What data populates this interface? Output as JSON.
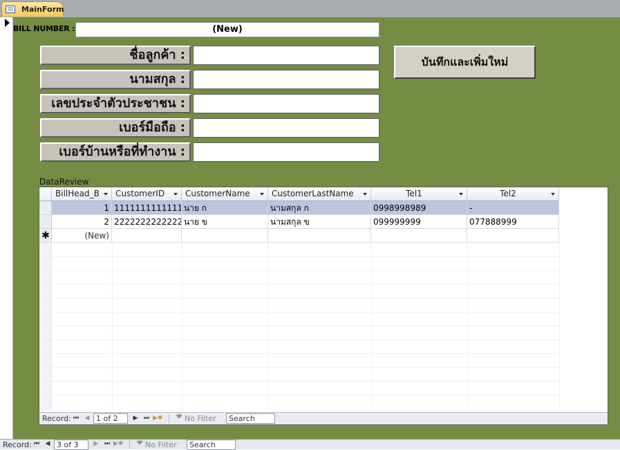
{
  "tab": {
    "title": "MainForm"
  },
  "form": {
    "bill_label": "BILL NUMBER :",
    "bill_value": "(New)",
    "fields": [
      {
        "label": "ชื่อลูกค้า :",
        "value": ""
      },
      {
        "label": "นามสกุล :",
        "value": ""
      },
      {
        "label": "เลขประจำตัวประชาชน :",
        "value": ""
      },
      {
        "label": "เบอร์มือถือ :",
        "value": ""
      },
      {
        "label": "เบอร์บ้านหรือที่ทำงาน :",
        "value": ""
      }
    ],
    "save_button": "บันทึกและเพิ่มใหม่",
    "subform_label": "DataReview"
  },
  "grid": {
    "columns": [
      "BillHead_B",
      "CustomerID",
      "CustomerName",
      "CustomerLastName",
      "Tel1",
      "Tel2"
    ],
    "rows": [
      {
        "billhead": "1",
        "customer_id": "1111111111111",
        "name": "นาย  ก",
        "lastname": "นามสกุล  ก",
        "tel1": "0998998989",
        "tel2": "-"
      },
      {
        "billhead": "2",
        "customer_id": "2222222222222",
        "name": "นาย  ข",
        "lastname": "นามสกุล  ข",
        "tel1": "099999999",
        "tel2": "077888999"
      }
    ],
    "new_row_label": "(New)"
  },
  "subnav": {
    "record_label": "Record:",
    "position": "1 of 2",
    "filter": "No Filter",
    "search": "Search"
  },
  "outernav": {
    "record_label": "Record:",
    "position": "3 of 3",
    "filter": "No Filter",
    "search": "Search"
  },
  "colors": {
    "form_bg": "#758c44",
    "tab_bg": "#f6c85b",
    "row_highlight": "#b9c6dd"
  },
  "icons": [
    "form-icon",
    "record-selector-arrow-icon",
    "dropdown-arrow-icon",
    "first-record-icon",
    "prev-record-icon",
    "next-record-icon",
    "last-record-icon",
    "new-record-icon",
    "filter-icon"
  ]
}
